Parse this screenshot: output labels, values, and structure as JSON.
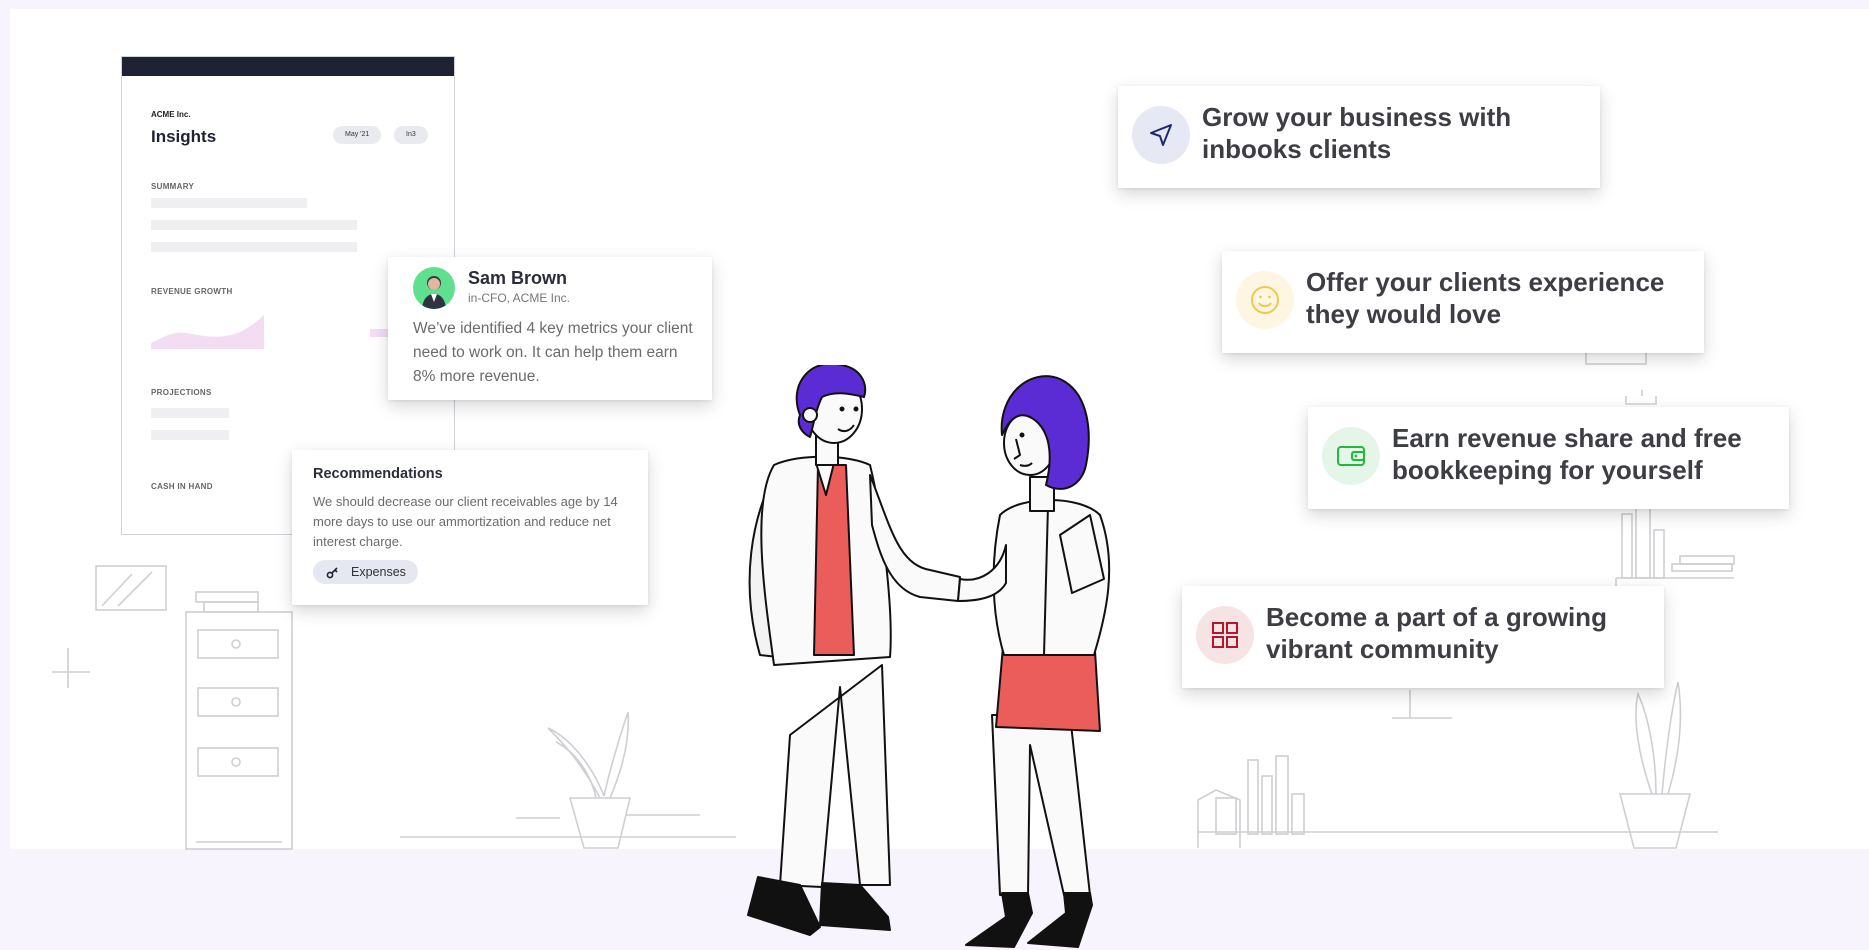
{
  "insights": {
    "company": "ACME Inc.",
    "title": "Insights",
    "pill_date": "May '21",
    "pill_short": "In3",
    "sections": {
      "summary": "SUMMARY",
      "revenue_growth": "REVENUE GROWTH",
      "projections": "PROJECTIONS",
      "cash_in_hand": "CASH IN HAND"
    }
  },
  "profile": {
    "name": "Sam Brown",
    "role": "in-CFO, ACME Inc.",
    "message": "We’ve identified 4 key metrics your client need to work on. It can help them earn 8% more revenue."
  },
  "recommendations": {
    "title": "Recommendations",
    "text": "We should decrease our client receivables age by 14 more days to use our ammortization and reduce net interest charge.",
    "tag": "Expenses"
  },
  "features": [
    {
      "text": "Grow your business with inbooks clients",
      "icon": "navigation-arrow-icon",
      "icon_bg": "#e6e8f4",
      "icon_color": "#1f2a6e"
    },
    {
      "text": "Offer your clients experience they would love",
      "icon": "smiley-icon",
      "icon_bg": "#fdf6e3",
      "icon_color": "#f2c84b"
    },
    {
      "text": "Earn revenue share and free bookkeeping for yourself",
      "icon": "wallet-icon",
      "icon_bg": "#e5f6e8",
      "icon_color": "#1fba3c"
    },
    {
      "text": "Become a part of a growing vibrant community",
      "icon": "grid-icon",
      "icon_bg": "#f6e4e4",
      "icon_color": "#b8142b"
    }
  ],
  "colors": {
    "accent_purple": "#5b2bd3",
    "coral": "#ea5d5a",
    "doc_header": "#1f2233",
    "page_bg": "#f8f4fe"
  }
}
